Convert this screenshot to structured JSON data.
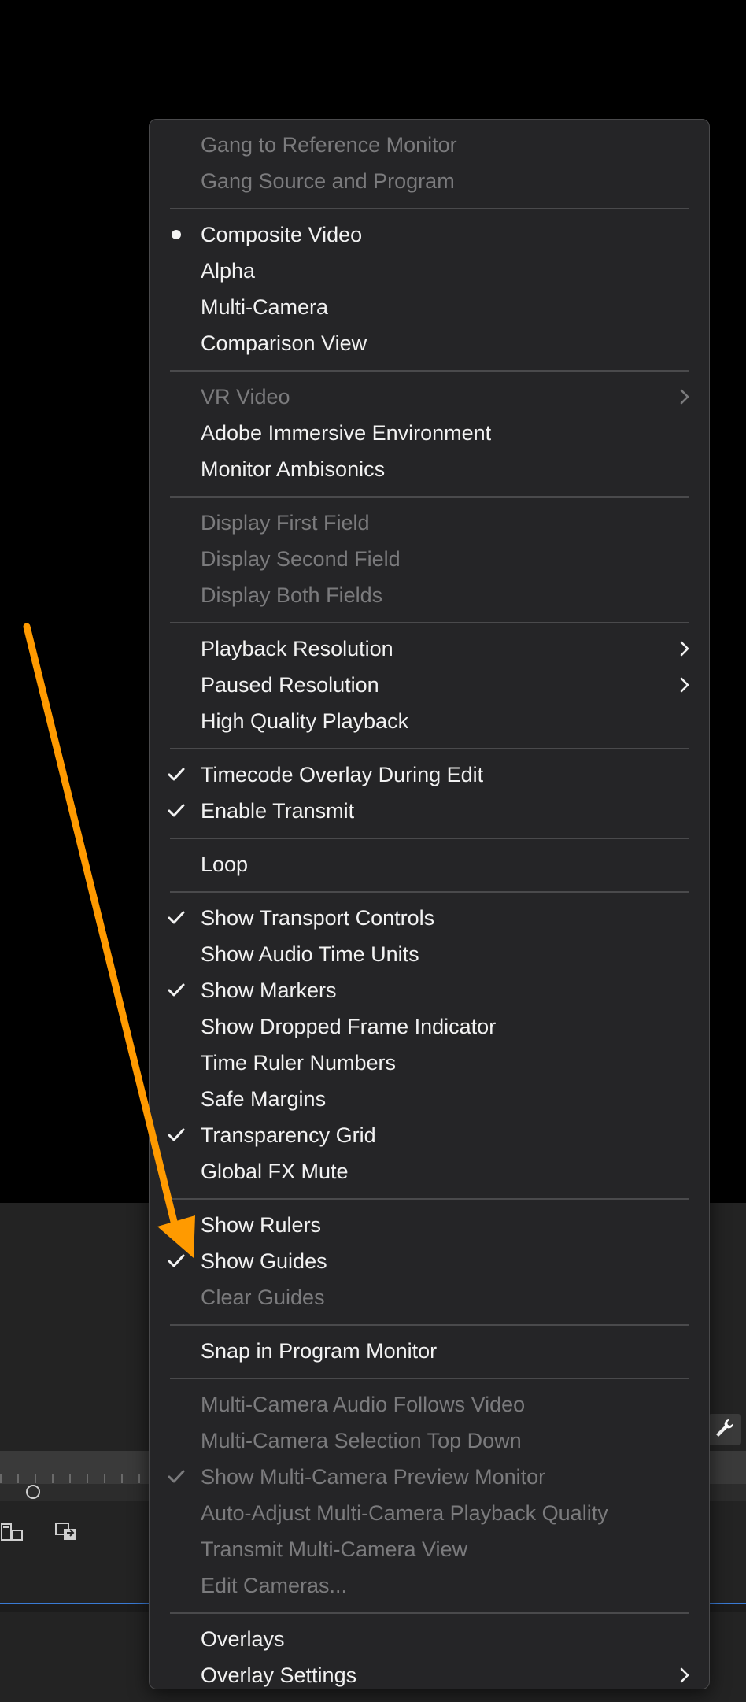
{
  "menu": {
    "groups": [
      [
        {
          "label": "Gang to Reference Monitor",
          "disabled": true
        },
        {
          "label": "Gang Source and Program",
          "disabled": true
        }
      ],
      [
        {
          "label": "Composite Video",
          "mark": "bullet"
        },
        {
          "label": "Alpha"
        },
        {
          "label": "Multi-Camera"
        },
        {
          "label": "Comparison View"
        }
      ],
      [
        {
          "label": "VR Video",
          "disabled": true,
          "submenu": true
        },
        {
          "label": "Adobe Immersive Environment"
        },
        {
          "label": "Monitor Ambisonics"
        }
      ],
      [
        {
          "label": "Display First Field",
          "disabled": true
        },
        {
          "label": "Display Second Field",
          "disabled": true
        },
        {
          "label": "Display Both Fields",
          "disabled": true
        }
      ],
      [
        {
          "label": "Playback Resolution",
          "submenu": true
        },
        {
          "label": "Paused Resolution",
          "submenu": true
        },
        {
          "label": "High Quality Playback"
        }
      ],
      [
        {
          "label": "Timecode Overlay During Edit",
          "mark": "check"
        },
        {
          "label": "Enable Transmit",
          "mark": "check"
        }
      ],
      [
        {
          "label": "Loop"
        }
      ],
      [
        {
          "label": "Show Transport Controls",
          "mark": "check"
        },
        {
          "label": "Show Audio Time Units"
        },
        {
          "label": "Show Markers",
          "mark": "check"
        },
        {
          "label": "Show Dropped Frame Indicator"
        },
        {
          "label": "Time Ruler Numbers"
        },
        {
          "label": "Safe Margins"
        },
        {
          "label": "Transparency Grid",
          "mark": "check"
        },
        {
          "label": "Global FX Mute"
        }
      ],
      [
        {
          "label": "Show Rulers"
        },
        {
          "label": "Show Guides",
          "mark": "check"
        },
        {
          "label": "Clear Guides",
          "disabled": true
        }
      ],
      [
        {
          "label": "Snap in Program Monitor"
        }
      ],
      [
        {
          "label": "Multi-Camera Audio Follows Video",
          "disabled": true
        },
        {
          "label": "Multi-Camera Selection Top Down",
          "disabled": true
        },
        {
          "label": "Show Multi-Camera Preview Monitor",
          "disabled": true,
          "mark": "check"
        },
        {
          "label": "Auto-Adjust Multi-Camera Playback Quality",
          "disabled": true
        },
        {
          "label": "Transmit Multi-Camera View",
          "disabled": true
        },
        {
          "label": "Edit Cameras...",
          "disabled": true
        }
      ],
      [
        {
          "label": "Overlays"
        },
        {
          "label": "Overlay Settings",
          "submenu": true
        }
      ]
    ]
  },
  "icons": {
    "check": "checkmark-icon",
    "bullet": "bullet-icon",
    "submenu": "chevron-right-icon",
    "wrench": "wrench-icon",
    "annotation": "annotation-arrow-icon"
  },
  "colors": {
    "menu_bg": "#252527",
    "menu_text": "#f2f2f2",
    "menu_text_disabled": "#7b7b7d",
    "separator": "#4a4a4c",
    "annotation_arrow": "#ff9a00",
    "timeline_accent": "#3a7bd5"
  }
}
